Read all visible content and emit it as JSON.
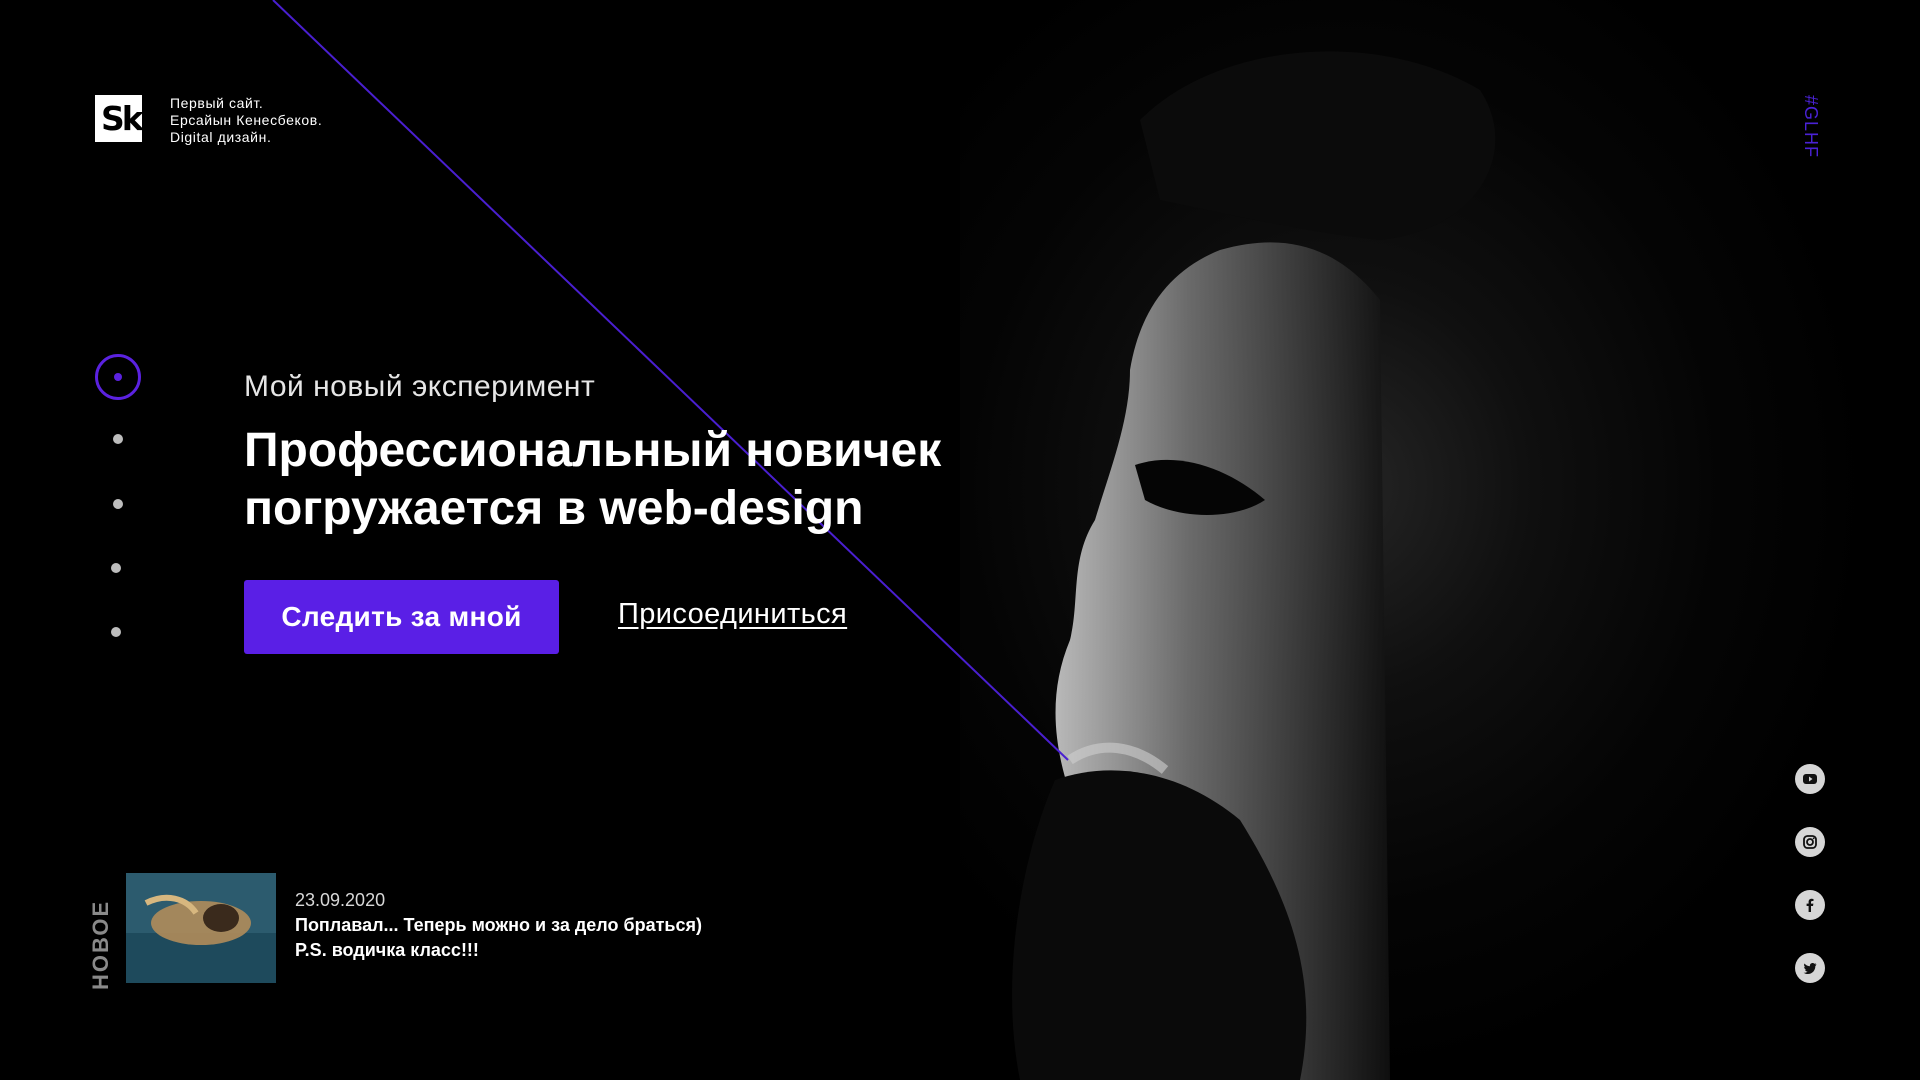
{
  "brand": {
    "logo_text": "Sk",
    "tagline": [
      "Первый сайт.",
      "Ерсайын Кенесбеков.",
      "Digital дизайн."
    ]
  },
  "side_tag": "#GLHF",
  "slider": {
    "active_index": 0,
    "count": 5
  },
  "hero": {
    "subtitle": "Мой новый эксперимент",
    "headline": [
      "Профессиональный новичек",
      "погружается в web-design"
    ],
    "primary_button": "Следить за мной",
    "secondary_link": "Присоединиться"
  },
  "news": {
    "label": "НОВОЕ",
    "date": "23.09.2020",
    "text": [
      "Поплавал... Теперь можно и за дело браться)",
      "P.S. водичка класс!!!"
    ]
  },
  "social": [
    {
      "icon": "youtube-icon"
    },
    {
      "icon": "instagram-icon"
    },
    {
      "icon": "facebook-icon"
    },
    {
      "icon": "twitter-icon"
    }
  ],
  "colors": {
    "accent": "#5a1fe6",
    "background": "#000000"
  }
}
